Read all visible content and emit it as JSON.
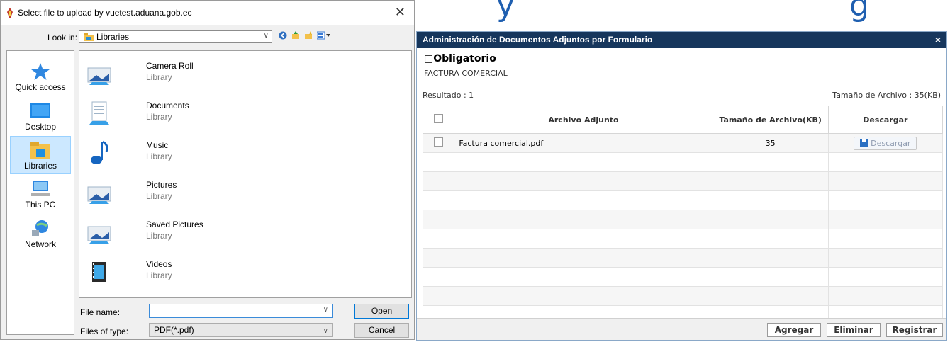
{
  "dialog": {
    "title": "Select file to upload by vuetest.aduana.gob.ec",
    "look_in_label": "Look in:",
    "look_in_value": "Libraries",
    "places": [
      {
        "label": "Quick access",
        "icon": "star-icon"
      },
      {
        "label": "Desktop",
        "icon": "desktop-icon"
      },
      {
        "label": "Libraries",
        "icon": "libraries-icon",
        "selected": true
      },
      {
        "label": "This PC",
        "icon": "computer-icon"
      },
      {
        "label": "Network",
        "icon": "network-icon"
      }
    ],
    "files": [
      {
        "name": "Camera Roll",
        "type": "Library",
        "icon": "pictures-library-icon"
      },
      {
        "name": "Documents",
        "type": "Library",
        "icon": "documents-library-icon"
      },
      {
        "name": "Music",
        "type": "Library",
        "icon": "music-library-icon"
      },
      {
        "name": "Pictures",
        "type": "Library",
        "icon": "pictures-library-icon"
      },
      {
        "name": "Saved Pictures",
        "type": "Library",
        "icon": "pictures-library-icon"
      },
      {
        "name": "Videos",
        "type": "Library",
        "icon": "videos-library-icon"
      }
    ],
    "file_name_label": "File name:",
    "file_name_value": "",
    "file_type_label": "Files of type:",
    "file_type_value": "PDF(*.pdf)",
    "open_label": "Open",
    "cancel_label": "Cancel"
  },
  "panel": {
    "title": "Administración de Documentos Adjuntos por Formulario",
    "close": "×",
    "heading": "□Obligatorio",
    "subheading": "FACTURA COMERCIAL",
    "result": "Resultado : 1",
    "size_total": "Tamaño de Archivo : 35(KB)",
    "columns": [
      "Archivo Adjunto",
      "Tamaño de Archivo(KB)",
      "Descargar"
    ],
    "rows": [
      {
        "file": "Factura comercial.pdf",
        "size": "35",
        "action": "Descargar"
      }
    ],
    "buttons": {
      "add": "Agregar",
      "delete": "Eliminar",
      "register": "Registrar"
    }
  },
  "colors": {
    "panel_title_bg": "#16365c",
    "selection": "#cce8ff",
    "accent": "#0078d7"
  }
}
